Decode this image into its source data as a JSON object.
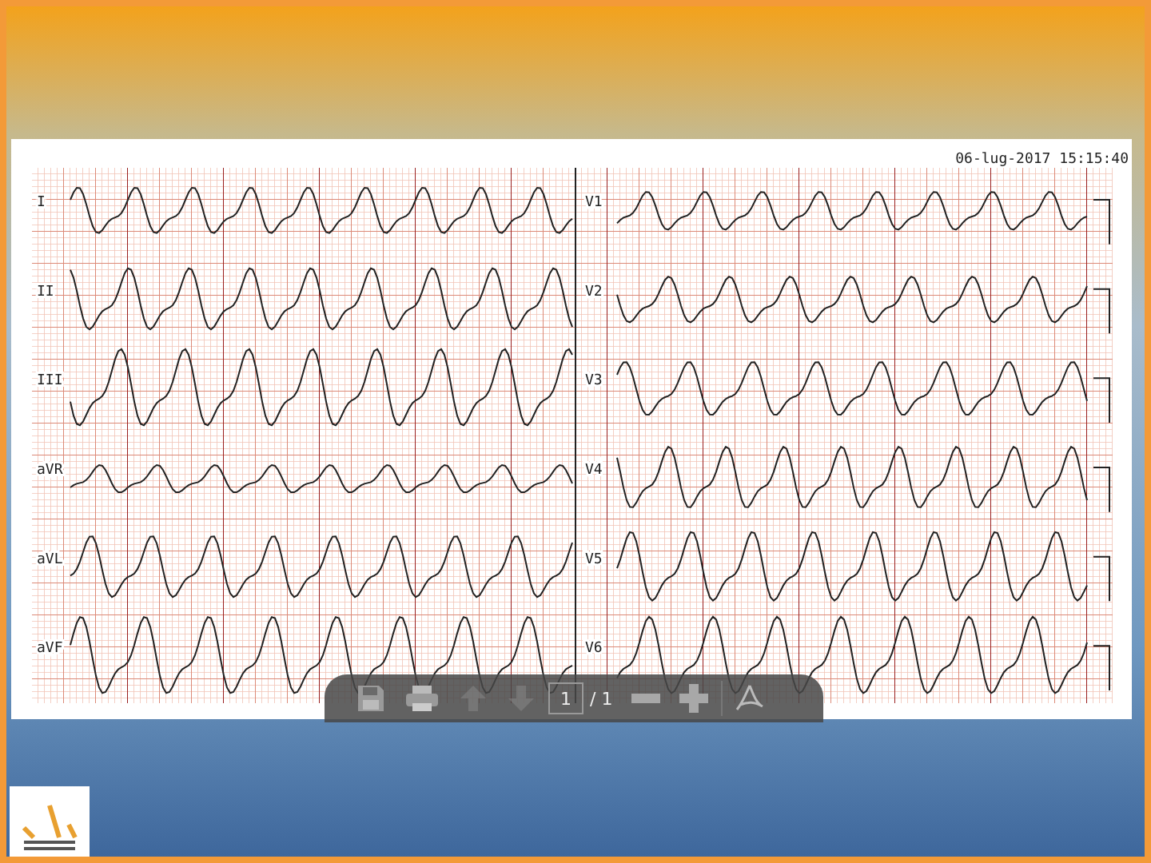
{
  "ecg": {
    "timestamp": "06-lug-2017 15:15:40",
    "leads_left": [
      "I",
      "II",
      "III",
      "aVR",
      "aVL",
      "aVF"
    ],
    "leads_right": [
      "V1",
      "V2",
      "V3",
      "V4",
      "V5",
      "V6"
    ]
  },
  "viewer_toolbar": {
    "buttons": [
      {
        "kind": "save",
        "disabled": false
      },
      {
        "kind": "print",
        "disabled": false
      },
      {
        "kind": "prev",
        "disabled": true
      },
      {
        "kind": "next",
        "disabled": true
      }
    ],
    "page": "1",
    "page_total": "/ 1",
    "zoom_buttons": [
      {
        "kind": "zoom-out"
      },
      {
        "kind": "zoom-in"
      }
    ]
  }
}
